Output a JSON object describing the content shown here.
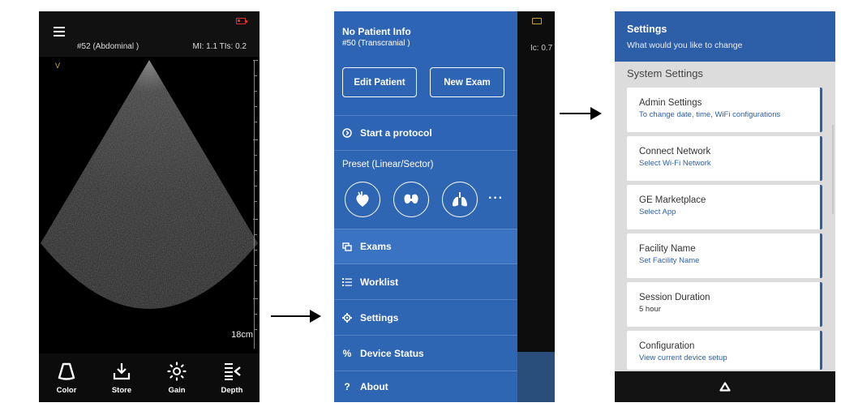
{
  "imaging": {
    "preset": "#52 (Abdominal )",
    "mi_tis": "MI: 1.1  TIs: 0.2",
    "orientation_marker": "V",
    "depth_label": "18cm",
    "toolbar": [
      {
        "label": "Color",
        "icon": "probe-icon"
      },
      {
        "label": "Store",
        "icon": "download-tray-icon"
      },
      {
        "label": "Gain",
        "icon": "sun-icon"
      },
      {
        "label": "Depth",
        "icon": "depth-lines-icon"
      }
    ]
  },
  "drawer": {
    "patient": "No Patient Info",
    "exam": "#50 (Transcranial )",
    "bg_text": "Ic: 0.7",
    "edit_patient": "Edit Patient",
    "new_exam": "New Exam",
    "start_protocol": "Start a protocol",
    "preset_label": "Preset (Linear/Sector)",
    "presets": [
      "cardiac-icon",
      "thyroid-icon",
      "lung-icon"
    ],
    "more": "···",
    "menu": {
      "exams": "Exams",
      "worklist": "Worklist",
      "settings": "Settings",
      "device_status": "Device Status",
      "about": "About"
    }
  },
  "settings": {
    "title": "Settings",
    "subtitle": "What would you like to change",
    "section": "System Settings",
    "items": [
      {
        "title": "Admin Settings",
        "sub": "To change date, time, WiFi configurations"
      },
      {
        "title": "Connect Network",
        "sub": "Select Wi-Fi Network"
      },
      {
        "title": "GE Marketplace",
        "sub": "Select App"
      },
      {
        "title": "Facility Name",
        "sub": "Set Facility Name"
      },
      {
        "title": "Session Duration",
        "sub": "5 hour"
      },
      {
        "title": "Configuration",
        "sub": "View current device setup"
      }
    ]
  },
  "colors": {
    "accent_blue": "#2d5fa8",
    "drawer_blue": "#2f66b4",
    "battery_red": "#e03030",
    "battery_amber": "#c9a12c"
  }
}
